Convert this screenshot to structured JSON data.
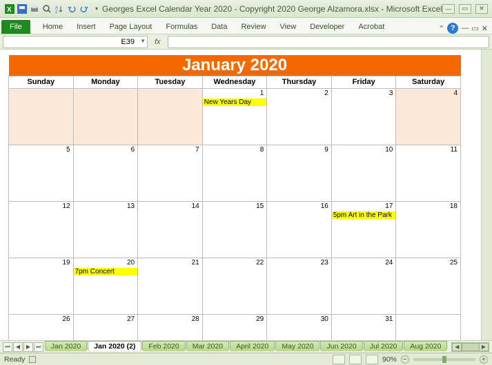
{
  "title": "Georges Excel Calendar Year 2020 - Copyright 2020 George Alzamora.xlsx - Microsoft Excel",
  "ribbon": {
    "file": "File",
    "tabs": [
      "Home",
      "Insert",
      "Page Layout",
      "Formulas",
      "Data",
      "Review",
      "View",
      "Developer",
      "Acrobat"
    ]
  },
  "namebox": "E39",
  "fx": "fx",
  "calendar": {
    "title": "January 2020",
    "days": [
      "Sunday",
      "Monday",
      "Tuesday",
      "Wednesday",
      "Thursday",
      "Friday",
      "Saturday"
    ],
    "weeks": [
      [
        {
          "n": "",
          "pad": true
        },
        {
          "n": "",
          "pad": true
        },
        {
          "n": "",
          "pad": true
        },
        {
          "n": "1",
          "event": "New Years Day"
        },
        {
          "n": "2"
        },
        {
          "n": "3"
        },
        {
          "n": "4",
          "pad": true
        }
      ],
      [
        {
          "n": "5"
        },
        {
          "n": "6"
        },
        {
          "n": "7"
        },
        {
          "n": "8"
        },
        {
          "n": "9"
        },
        {
          "n": "10"
        },
        {
          "n": "11"
        }
      ],
      [
        {
          "n": "12"
        },
        {
          "n": "13"
        },
        {
          "n": "14"
        },
        {
          "n": "15"
        },
        {
          "n": "16"
        },
        {
          "n": "17",
          "event": "5pm Art in the Park"
        },
        {
          "n": "18"
        }
      ],
      [
        {
          "n": "19"
        },
        {
          "n": "20",
          "event": "7pm Concert"
        },
        {
          "n": "21"
        },
        {
          "n": "22"
        },
        {
          "n": "23"
        },
        {
          "n": "24"
        },
        {
          "n": "25"
        }
      ],
      [
        {
          "n": "26"
        },
        {
          "n": "27"
        },
        {
          "n": "28"
        },
        {
          "n": "29"
        },
        {
          "n": "30"
        },
        {
          "n": "31"
        },
        {
          "n": ""
        }
      ]
    ]
  },
  "sheets": [
    "Jan 2020",
    "Jan 2020 (2)",
    "Feb 2020",
    "Mar 2020",
    "April 2020",
    "May 2020",
    "Jun 2020",
    "Jul 2020",
    "Aug 2020"
  ],
  "active_sheet": 1,
  "status": {
    "ready": "Ready",
    "zoom": "90%"
  }
}
